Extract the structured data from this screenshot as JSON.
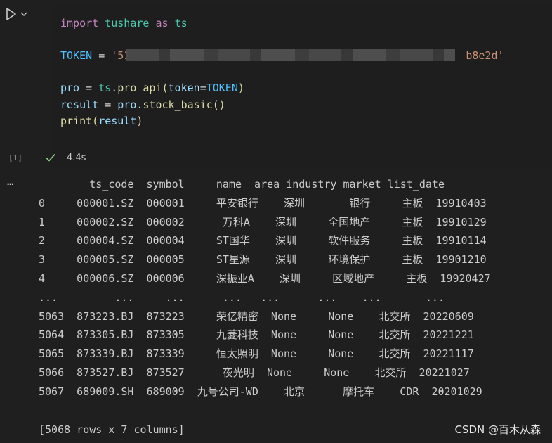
{
  "cell": {
    "execution_count": "[1]",
    "status_time": "4.4s",
    "code": {
      "l1": [
        "import",
        "tushare",
        "as",
        "ts"
      ],
      "l2": [
        "TOKEN",
        "=",
        "'51",
        "b8e2d'"
      ],
      "l3": [
        "pro",
        "=",
        "ts",
        ".",
        "pro_api",
        "(",
        "token",
        "=",
        "TOKEN",
        ")"
      ],
      "l4": [
        "result",
        "=",
        "pro",
        ".",
        "stock_basic",
        "()"
      ],
      "l5": [
        "print",
        "(",
        "result",
        ")"
      ]
    }
  },
  "output": {
    "more_label": "…",
    "lines": [
      "        ts_code  symbol     name  area industry market list_date",
      "0     000001.SZ  000001     平安银行    深圳       银行     主板  19910403",
      "1     000002.SZ  000002      万科A    深圳     全国地产     主板  19910129",
      "2     000004.SZ  000004     ST国华    深圳     软件服务     主板  19910114",
      "3     000005.SZ  000005     ST星源    深圳     环境保护     主板  19901210",
      "4     000006.SZ  000006     深振业A    深圳     区域地产     主板  19920427",
      "...         ...     ...      ...   ...      ...    ...       ...",
      "5063  873223.BJ  873223     荣亿精密  None     None    北交所  20220609",
      "5064  873305.BJ  873305     九菱科技  None     None    北交所  20221221",
      "5065  873339.BJ  873339     恒太照明  None     None    北交所  20221117",
      "5066  873527.BJ  873527      夜光明  None     None    北交所  20221027",
      "5067  689009.SH  689009  九号公司-WD    北京      摩托车    CDR  20201029",
      "",
      "[5068 rows x 7 columns]"
    ]
  },
  "watermark": "CSDN @百木从森",
  "colors": {
    "background": "#1f1f1f",
    "keyword": "#c586c0",
    "module": "#4ec9b0",
    "string": "#ce9178",
    "success": "#89d185"
  }
}
